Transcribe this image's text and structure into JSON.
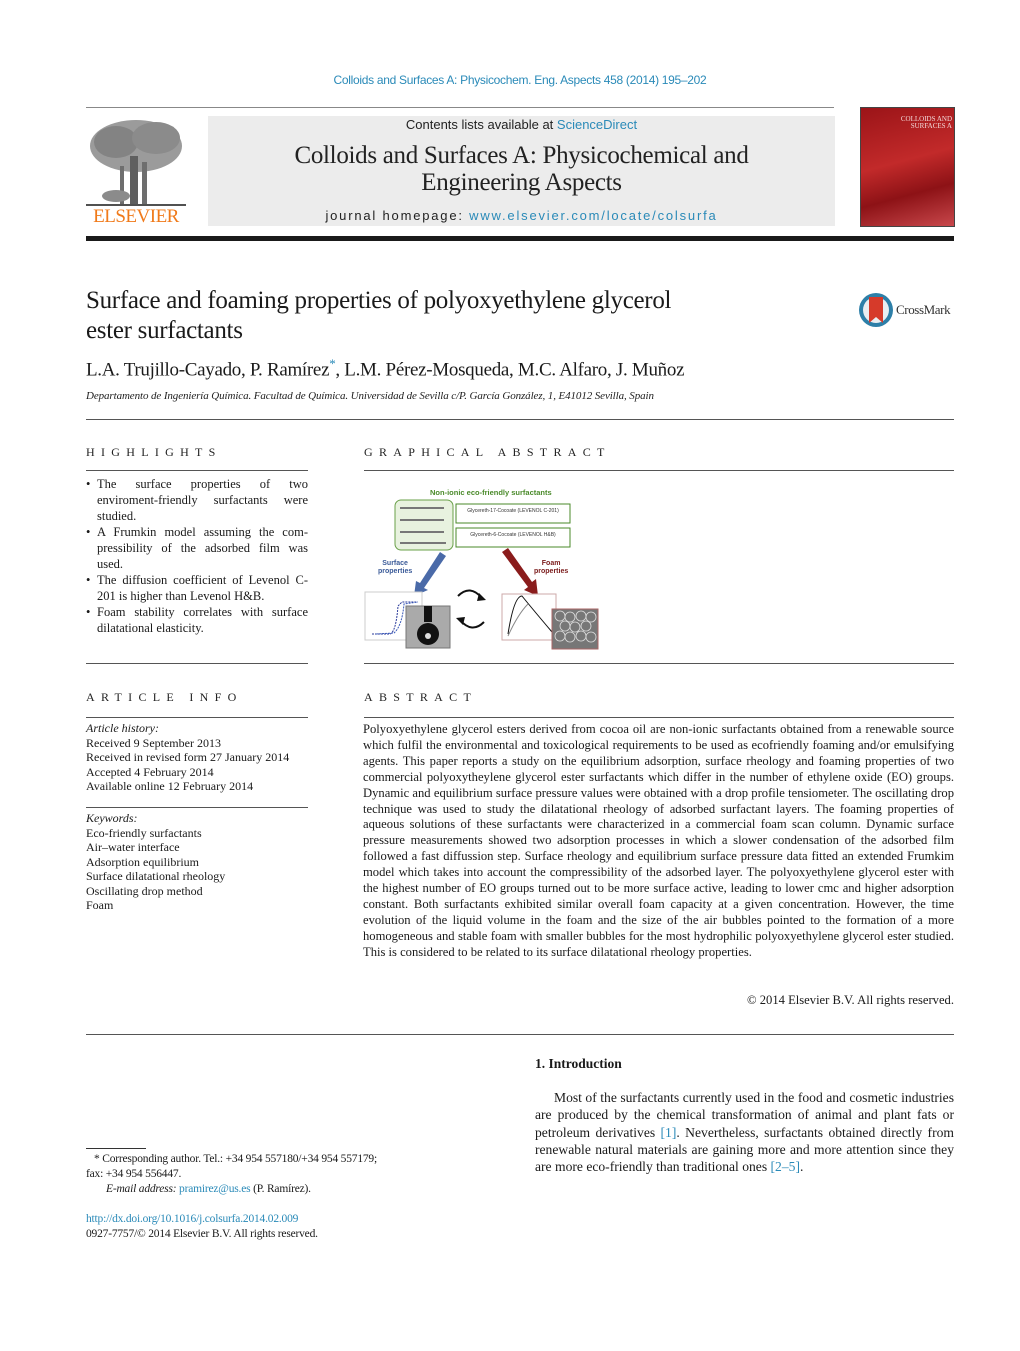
{
  "header": {
    "citation": "Colloids and Surfaces A: Physicochem. Eng. Aspects 458 (2014) 195–202",
    "contents_prefix": "Contents lists available at ",
    "contents_link": "ScienceDirect",
    "journal_title_line1": "Colloids and Surfaces A: Physicochemical and",
    "journal_title_line2": "Engineering Aspects",
    "homepage_prefix": "journal homepage: ",
    "homepage_link": "www.elsevier.com/locate/colsurfa",
    "publisher_logo_text": "ELSEVIER",
    "cover_title_line1": "COLLOIDS AND",
    "cover_title_line2": "SURFACES A"
  },
  "article": {
    "title_line1": "Surface and foaming properties of polyoxyethylene glycerol",
    "title_line2": "ester surfactants",
    "crossmark_label": "CrossMark",
    "authors_part1": "L.A. Trujillo-Cayado, P. Ramírez",
    "authors_star": "*",
    "authors_part2": ", L.M. Pérez-Mosqueda, M.C. Alfaro, J. Muñoz",
    "affiliation": "Departamento de Ingeniería Química. Facultad de Química. Universidad de Sevilla c/P. García González, 1, E41012 Sevilla, Spain"
  },
  "highlights": {
    "heading": "HIGHLIGHTS",
    "items": [
      "The surface properties of two enviroment-friendly surfactants were studied.",
      "A Frumkin model assuming the com­pressibility of the adsorbed film was used.",
      "The diffusion coefficient of Levenol C-201 is higher than Levenol H&B.",
      "Foam stability correlates with surface dilatational elasticity."
    ]
  },
  "graphical_abstract": {
    "heading": "GRAPHICAL ABSTRACT",
    "title": "Non-ionic eco-friendly surfactants",
    "box1": "Glycereth-17-Cocoate (LEVENOL C-201)",
    "box2": "Glycereth-6-Cocoate (LEVENOL H&B)",
    "left_label_line1": "Surface",
    "left_label_line2": "properties",
    "right_label_line1": "Foam",
    "right_label_line2": "properties"
  },
  "article_info": {
    "heading": "ARTICLE INFO",
    "history_label": "Article history:",
    "history": [
      "Received 9 September 2013",
      "Received in revised form 27 January 2014",
      "Accepted 4 February 2014",
      "Available online 12 February 2014"
    ],
    "keywords_label": "Keywords:",
    "keywords": [
      "Eco-friendly surfactants",
      "Air–water interface",
      "Adsorption equilibrium",
      "Surface dilatational rheology",
      "Oscillating drop method",
      "Foam"
    ]
  },
  "abstract": {
    "heading": "ABSTRACT",
    "text": "Polyoxyethylene glycerol esters derived from cocoa oil are non-ionic surfactants obtained from a renew­able source which fulfil the environmental and toxicological requirements to be used as ecofriendly foaming and/or emulsifying agents. This paper reports a study on the equilibrium adsorption, surface rheology and foaming properties of two commercial polyoxytheylene glycerol ester surfactants which differ in the number of ethylene oxide (EO) groups. Dynamic and equilibrium surface pressure values were obtained with a drop profile tensiometer. The oscillating drop technique was used to study the dilatational rheology of adsorbed surfactant layers. The foaming properties of aqueous solutions of these surfactants were characterized in a commercial foam scan column. Dynamic surface pressure measure­ments showed two adsorption processes in which a slower condensation of the adsorbed film followed a fast diffussion step. Surface rheology and equilibrium surface pressure data fitted an extended Frumkim model which takes into account the compressibility of the adsorbed layer. The polyoxyethylene glyc­erol ester with the highest number of EO groups turned out to be more surface active, leading to lower cmc and higher adsorption constant. Both surfactants exhibited similar overall foam capacity at a given concentration. However, the time evolution of the liquid volume in the foam and the size of the air bubbles pointed to the formation of a more homogeneous and stable foam with smaller bubbles for the most hydrophilic polyoxyethylene glycerol ester studied. This is considered to be related to its surface dilatational rheology properties.",
    "copyright": "© 2014 Elsevier B.V. All rights reserved."
  },
  "footnote": {
    "corresponding": "* Corresponding author. Tel.: +34 954 557180/+34 954 557179;",
    "fax": "fax: +34 954 556447.",
    "email_label": "E-mail address: ",
    "email": "pramirez@us.es",
    "email_suffix": " (P. Ramírez).",
    "doi": "http://dx.doi.org/10.1016/j.colsurfa.2014.02.009",
    "issn": "0927-7757/© 2014 Elsevier B.V. All rights reserved."
  },
  "introduction": {
    "heading": "1.  Introduction",
    "text_part1": "Most of the surfactants currently used in the food and cos­metic industries are produced by the chemical transformation of animal and plant fats or petroleum derivatives ",
    "ref1": "[1]",
    "text_part2": ". Nevertheless, surfactants obtained directly from renewable natural materials are gaining more and more attention since they are more eco-friendly than traditional ones ",
    "ref2": "[2–5]",
    "text_part3": "."
  },
  "colors": {
    "link": "#2a8ab8",
    "elsevier_orange": "#f07a1a",
    "cover_red": "#b3201f",
    "ga_green": "#4a8a2a",
    "ga_blue_arrow": "#4a6aa8",
    "ga_red_arrow": "#8a1c1c"
  }
}
